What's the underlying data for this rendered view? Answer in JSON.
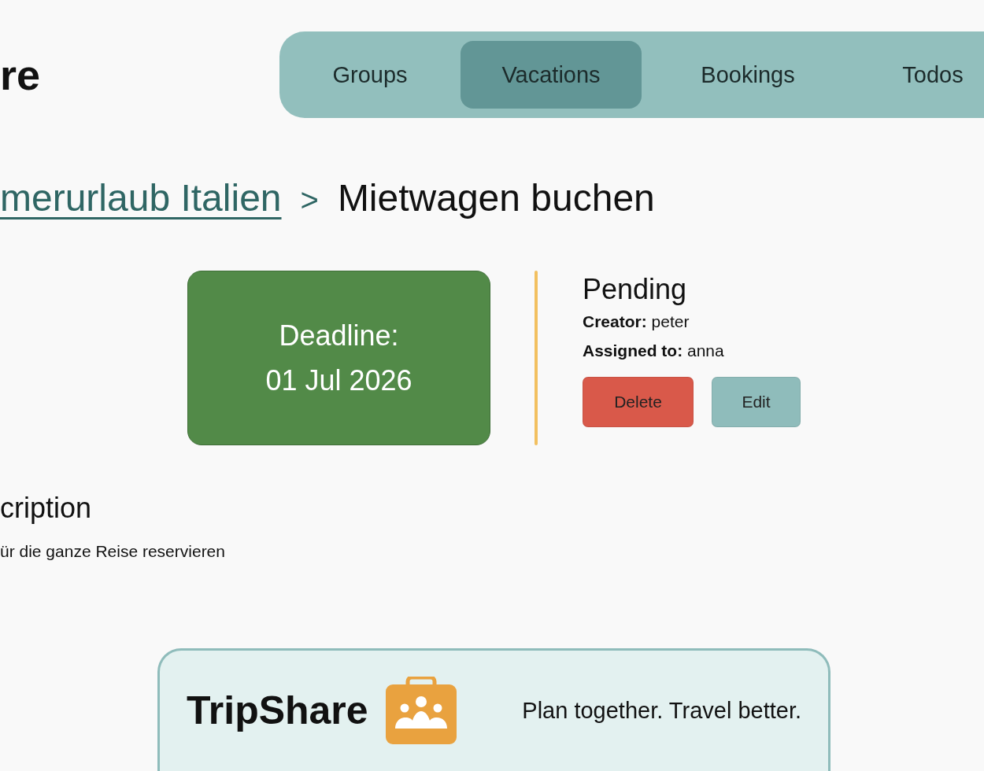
{
  "header": {
    "logo_text": "re"
  },
  "nav": {
    "tabs": [
      {
        "label": "Groups",
        "selected": false
      },
      {
        "label": "Vacations",
        "selected": true
      },
      {
        "label": "Bookings",
        "selected": false
      },
      {
        "label": "Todos",
        "selected": false
      }
    ]
  },
  "breadcrumb": {
    "parent": "merurlaub Italien",
    "separator": ">",
    "current": "Mietwagen buchen"
  },
  "todo": {
    "deadline_label": "Deadline:",
    "deadline_date": "01 Jul 2026",
    "status": "Pending",
    "creator": "**Creator:** peter",
    "assigned": "**Assigned to:** anna",
    "buttons": [
      {
        "kind": "danger",
        "label": "Delete"
      },
      {
        "kind": "secondary",
        "label": "Edit"
      }
    ]
  },
  "description": {
    "heading": "cription",
    "text": "ür die ganze Reise reservieren"
  },
  "footer": {
    "brand": "TripShare",
    "tagline": "Plan together. Travel better."
  }
}
